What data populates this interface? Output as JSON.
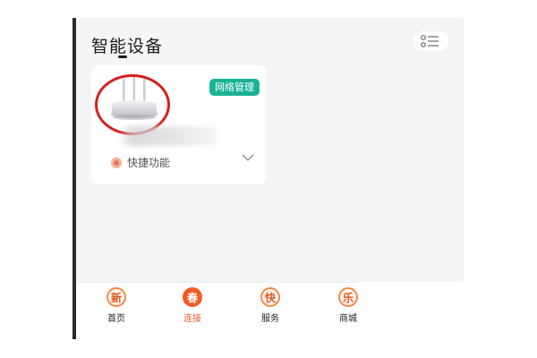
{
  "header": {
    "title": "智能设备"
  },
  "device_card": {
    "badge_label": "网络管理",
    "quick_label": "快捷功能"
  },
  "tabs": [
    {
      "label": "首页",
      "icon_char": "新",
      "active": false
    },
    {
      "label": "连接",
      "icon_char": "春",
      "active": true
    },
    {
      "label": "服务",
      "icon_char": "快",
      "active": false
    },
    {
      "label": "商城",
      "icon_char": "乐",
      "active": false
    }
  ],
  "colors": {
    "accent": "#f25a24",
    "badge": "#19b394",
    "highlight_circle": "#d6201d"
  }
}
